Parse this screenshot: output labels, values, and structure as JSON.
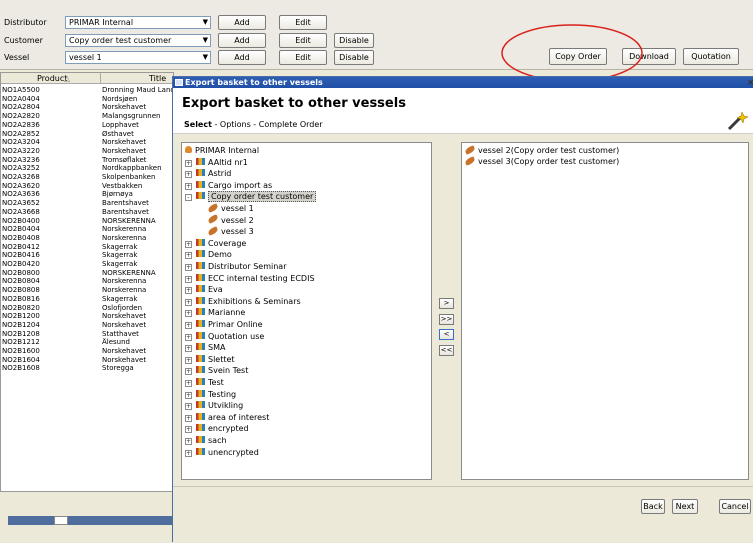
{
  "top": {
    "distributor": {
      "label": "Distributor",
      "value": "PRIMAR Internal",
      "add": "Add",
      "edit": "Edit"
    },
    "customer": {
      "label": "Customer",
      "value": "Copy order test customer",
      "add": "Add",
      "edit": "Edit",
      "disable": "Disable"
    },
    "vessel": {
      "label": "Vessel",
      "value": "vessel 1",
      "add": "Add",
      "edit": "Edit",
      "disable": "Disable"
    },
    "copy_order": "Copy Order",
    "download": "Download",
    "quotation": "Quotation"
  },
  "table": {
    "headers": [
      "Product",
      "Title"
    ],
    "rows": [
      [
        "NO1A5500",
        "Dronning Maud Land"
      ],
      [
        "NO2A0404",
        "Nordsjøen"
      ],
      [
        "NO2A2804",
        "Norskehavet"
      ],
      [
        "NO2A2820",
        "Malangsgrunnen"
      ],
      [
        "NO2A2836",
        "Lopphavet"
      ],
      [
        "NO2A2852",
        "Østhavet"
      ],
      [
        "NO2A3204",
        "Norskehavet"
      ],
      [
        "NO2A3220",
        "Norskehavet"
      ],
      [
        "NO2A3236",
        "Tromsøflaket"
      ],
      [
        "NO2A3252",
        "Nordkappbanken"
      ],
      [
        "NO2A3268",
        "Skolpenbanken"
      ],
      [
        "NO2A3620",
        "Vestbakken"
      ],
      [
        "NO2A3636",
        "Bjørnøya"
      ],
      [
        "NO2A3652",
        "Barentshavet"
      ],
      [
        "NO2A3668",
        "Barentshavet"
      ],
      [
        "NO2B0400",
        "NORSKERENNA"
      ],
      [
        "NO2B0404",
        "Norskerenna"
      ],
      [
        "NO2B0408",
        "Norskerenna"
      ],
      [
        "NO2B0412",
        "Skagerrak"
      ],
      [
        "NO2B0416",
        "Skagerrak"
      ],
      [
        "NO2B0420",
        "Skagerrak"
      ],
      [
        "NO2B0800",
        "NORSKERENNA"
      ],
      [
        "NO2B0804",
        "Norskerenna"
      ],
      [
        "NO2B0808",
        "Norskerenna"
      ],
      [
        "NO2B0816",
        "Skagerrak"
      ],
      [
        "NO2B0820",
        "Oslofjorden"
      ],
      [
        "NO2B1200",
        "Norskehavet"
      ],
      [
        "NO2B1204",
        "Norskehavet"
      ],
      [
        "NO2B1208",
        "Statthavet"
      ],
      [
        "NO2B1212",
        "Ålesund"
      ],
      [
        "NO2B1600",
        "Norskehavet"
      ],
      [
        "NO2B1604",
        "Norskehavet"
      ],
      [
        "NO2B1608",
        "Storegga"
      ]
    ]
  },
  "dialog": {
    "window_title": "Export basket to other vessels",
    "heading": "Export basket to other vessels",
    "steps": {
      "current": "Select",
      "rest": " - Options - Complete Order"
    },
    "tree": [
      {
        "label": "PRIMAR Internal",
        "icon": "user-icon",
        "level": 0,
        "pm": ""
      },
      {
        "label": "AAltid nr1",
        "icon": "group-icon",
        "level": 1,
        "pm": "+"
      },
      {
        "label": "Astrid",
        "icon": "group-icon",
        "level": 1,
        "pm": "+"
      },
      {
        "label": "Cargo import as",
        "icon": "group-icon",
        "level": 1,
        "pm": "+"
      },
      {
        "label": "Copy order test customer",
        "icon": "group-icon",
        "level": 1,
        "pm": "-",
        "selected": true
      },
      {
        "label": "vessel 1",
        "icon": "vessel-icon",
        "level": 2,
        "pm": ""
      },
      {
        "label": "vessel 2",
        "icon": "vessel-icon",
        "level": 2,
        "pm": ""
      },
      {
        "label": "vessel 3",
        "icon": "vessel-icon",
        "level": 2,
        "pm": ""
      },
      {
        "label": "Coverage",
        "icon": "group-icon",
        "level": 1,
        "pm": "+"
      },
      {
        "label": "Demo",
        "icon": "group-icon",
        "level": 1,
        "pm": "+"
      },
      {
        "label": "Distributor Seminar",
        "icon": "group-icon",
        "level": 1,
        "pm": "+"
      },
      {
        "label": "ECC internal testing ECDIS",
        "icon": "group-icon",
        "level": 1,
        "pm": "+"
      },
      {
        "label": "Eva",
        "icon": "group-icon",
        "level": 1,
        "pm": "+"
      },
      {
        "label": "Exhibitions & Seminars",
        "icon": "group-icon",
        "level": 1,
        "pm": "+"
      },
      {
        "label": "Marianne",
        "icon": "group-icon",
        "level": 1,
        "pm": "+"
      },
      {
        "label": "Primar Online",
        "icon": "group-icon",
        "level": 1,
        "pm": "+"
      },
      {
        "label": "Quotation use",
        "icon": "group-icon",
        "level": 1,
        "pm": "+"
      },
      {
        "label": "SMA",
        "icon": "group-icon",
        "level": 1,
        "pm": "+"
      },
      {
        "label": "Slettet",
        "icon": "group-icon",
        "level": 1,
        "pm": "+"
      },
      {
        "label": "Svein Test",
        "icon": "group-icon",
        "level": 1,
        "pm": "+"
      },
      {
        "label": "Test",
        "icon": "group-icon",
        "level": 1,
        "pm": "+"
      },
      {
        "label": "Testing",
        "icon": "group-icon",
        "level": 1,
        "pm": "+"
      },
      {
        "label": "Utvikling",
        "icon": "group-icon",
        "level": 1,
        "pm": "+"
      },
      {
        "label": "area of interest",
        "icon": "group-icon",
        "level": 1,
        "pm": "+"
      },
      {
        "label": "encrypted",
        "icon": "group-icon",
        "level": 1,
        "pm": "+"
      },
      {
        "label": "sach",
        "icon": "group-icon",
        "level": 1,
        "pm": "+"
      },
      {
        "label": "unencrypted",
        "icon": "group-icon",
        "level": 1,
        "pm": "+"
      }
    ],
    "selected_list": [
      "vessel 2(Copy order test customer)",
      "vessel 3(Copy order test customer)"
    ],
    "move_buttons": [
      ">",
      ">>",
      "<",
      "<<"
    ],
    "back": "Back",
    "next": "Next",
    "cancel": "Cancel"
  },
  "colors": {
    "highlight_circle": "#d9221c",
    "dialog_title": "#2452a8"
  }
}
